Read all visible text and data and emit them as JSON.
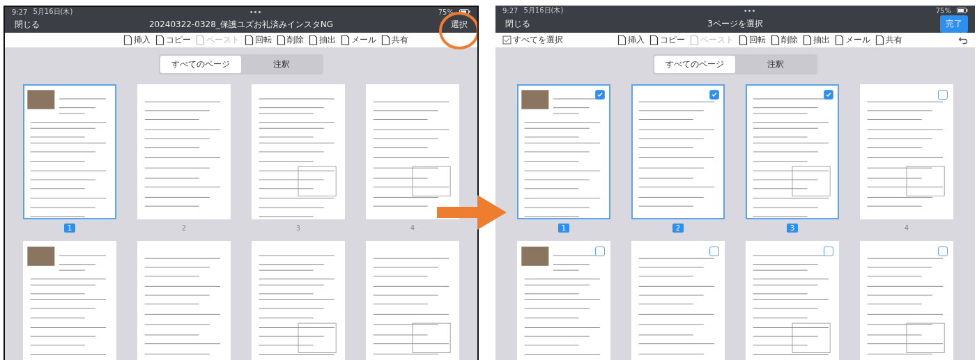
{
  "screens": [
    {
      "status_bar": {
        "time": "9:27",
        "date": "5月16日(木)",
        "handle": "•••",
        "battery": "75%"
      },
      "nav": {
        "left": "閉じる",
        "title": "20240322-0328_保護ユズお礼済みインスタNG",
        "right": {
          "label": "選択",
          "kind": "plain"
        }
      },
      "highlighted": true,
      "toolbar": {
        "items": [
          {
            "label": "挿入",
            "disabled": false
          },
          {
            "label": "コピー",
            "disabled": false
          },
          {
            "label": "ペースト",
            "disabled": true
          },
          {
            "label": "回転",
            "disabled": false
          },
          {
            "label": "削除",
            "disabled": false
          },
          {
            "label": "抽出",
            "disabled": false
          },
          {
            "label": "メール",
            "disabled": false
          },
          {
            "label": "共有",
            "disabled": false
          }
        ]
      },
      "segments": [
        {
          "label": "すべてのページ",
          "selected": true
        },
        {
          "label": "注釈",
          "selected": false
        }
      ],
      "pages": [
        {
          "number": "1",
          "selected": true
        },
        {
          "number": "2",
          "selected": false
        },
        {
          "number": "3",
          "selected": false
        },
        {
          "number": "4",
          "selected": false
        },
        {
          "selected": false
        },
        {
          "selected": false
        },
        {
          "selected": false
        },
        {
          "selected": false
        }
      ]
    },
    {
      "status_bar": {
        "time": "9:27",
        "date": "5月16日(木)",
        "handle": "•••",
        "battery": "75%"
      },
      "nav": {
        "left": "閉じる",
        "title": "3ページを選択",
        "right": {
          "label": "完了",
          "kind": "filled"
        }
      },
      "highlighted": false,
      "toolbar": {
        "select_all": "すべてを選択",
        "undo": true,
        "items": [
          {
            "label": "挿入",
            "disabled": false
          },
          {
            "label": "コピー",
            "disabled": false
          },
          {
            "label": "ペースト",
            "disabled": true
          },
          {
            "label": "回転",
            "disabled": false
          },
          {
            "label": "削除",
            "disabled": false
          },
          {
            "label": "抽出",
            "disabled": false
          },
          {
            "label": "メール",
            "disabled": false
          },
          {
            "label": "共有",
            "disabled": false
          }
        ]
      },
      "segments": [
        {
          "label": "すべてのページ",
          "selected": true
        },
        {
          "label": "注釈",
          "selected": false
        }
      ],
      "pages": [
        {
          "number": "1",
          "selected": true,
          "checked": true
        },
        {
          "number": "2",
          "selected": true,
          "checked": true
        },
        {
          "number": "3",
          "selected": true,
          "checked": true
        },
        {
          "number": "4",
          "selected": false,
          "checked": false
        },
        {
          "selected": false,
          "checked": false
        },
        {
          "selected": false,
          "checked": false
        },
        {
          "selected": false,
          "checked": false
        },
        {
          "selected": false,
          "checked": false
        }
      ]
    }
  ]
}
